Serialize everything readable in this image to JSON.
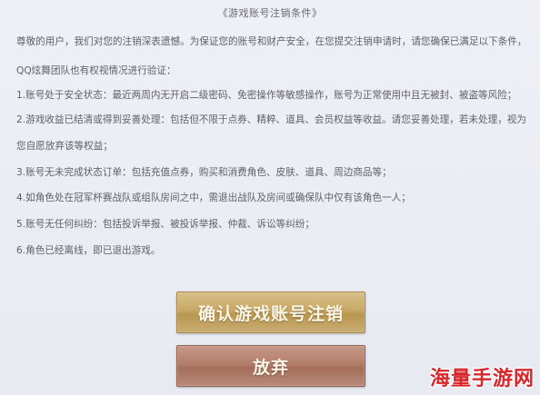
{
  "title": "《游戏账号注销条件》",
  "paragraphs": [
    "尊敬的用户，我们对您的注销深表遗憾。为保证您的账号和财产安全，在您提交注销申请时，请您确保已满足以下条件，",
    "QQ炫舞团队也有权视情况进行验证：",
    "1.账号处于安全状态：最近两周内无开启二级密码、免密操作等敏感操作，账号为正常使用中且无被封、被盗等风险；",
    "2.游戏收益已结清或得到妥善处理：包括但不限于点券、精粹、道具、会员权益等收益。请您妥善处理，若未处理，视为",
    "您自愿放弃该等权益；",
    "3.账号无未完成状态订单：包括充值点券，购买和消费角色、皮肤、道具、周边商品等；",
    "4.如角色处在冠军杯赛战队或组队房间之中，需退出战队及房间或确保队中仅有该角色一人；",
    "5.账号无任何纠纷：包括投诉举报、被投诉举报、仲裁、诉讼等纠纷；",
    "6.角色已经离线，即已退出游戏。"
  ],
  "buttons": {
    "confirm": "确认游戏账号注销",
    "abandon": "放弃"
  },
  "watermark": "海量手游网",
  "colors": {
    "background": "#e9ebf3",
    "confirm_button": "#c7a865",
    "abandon_button": "#b27e6b",
    "watermark": "#d7262b"
  }
}
